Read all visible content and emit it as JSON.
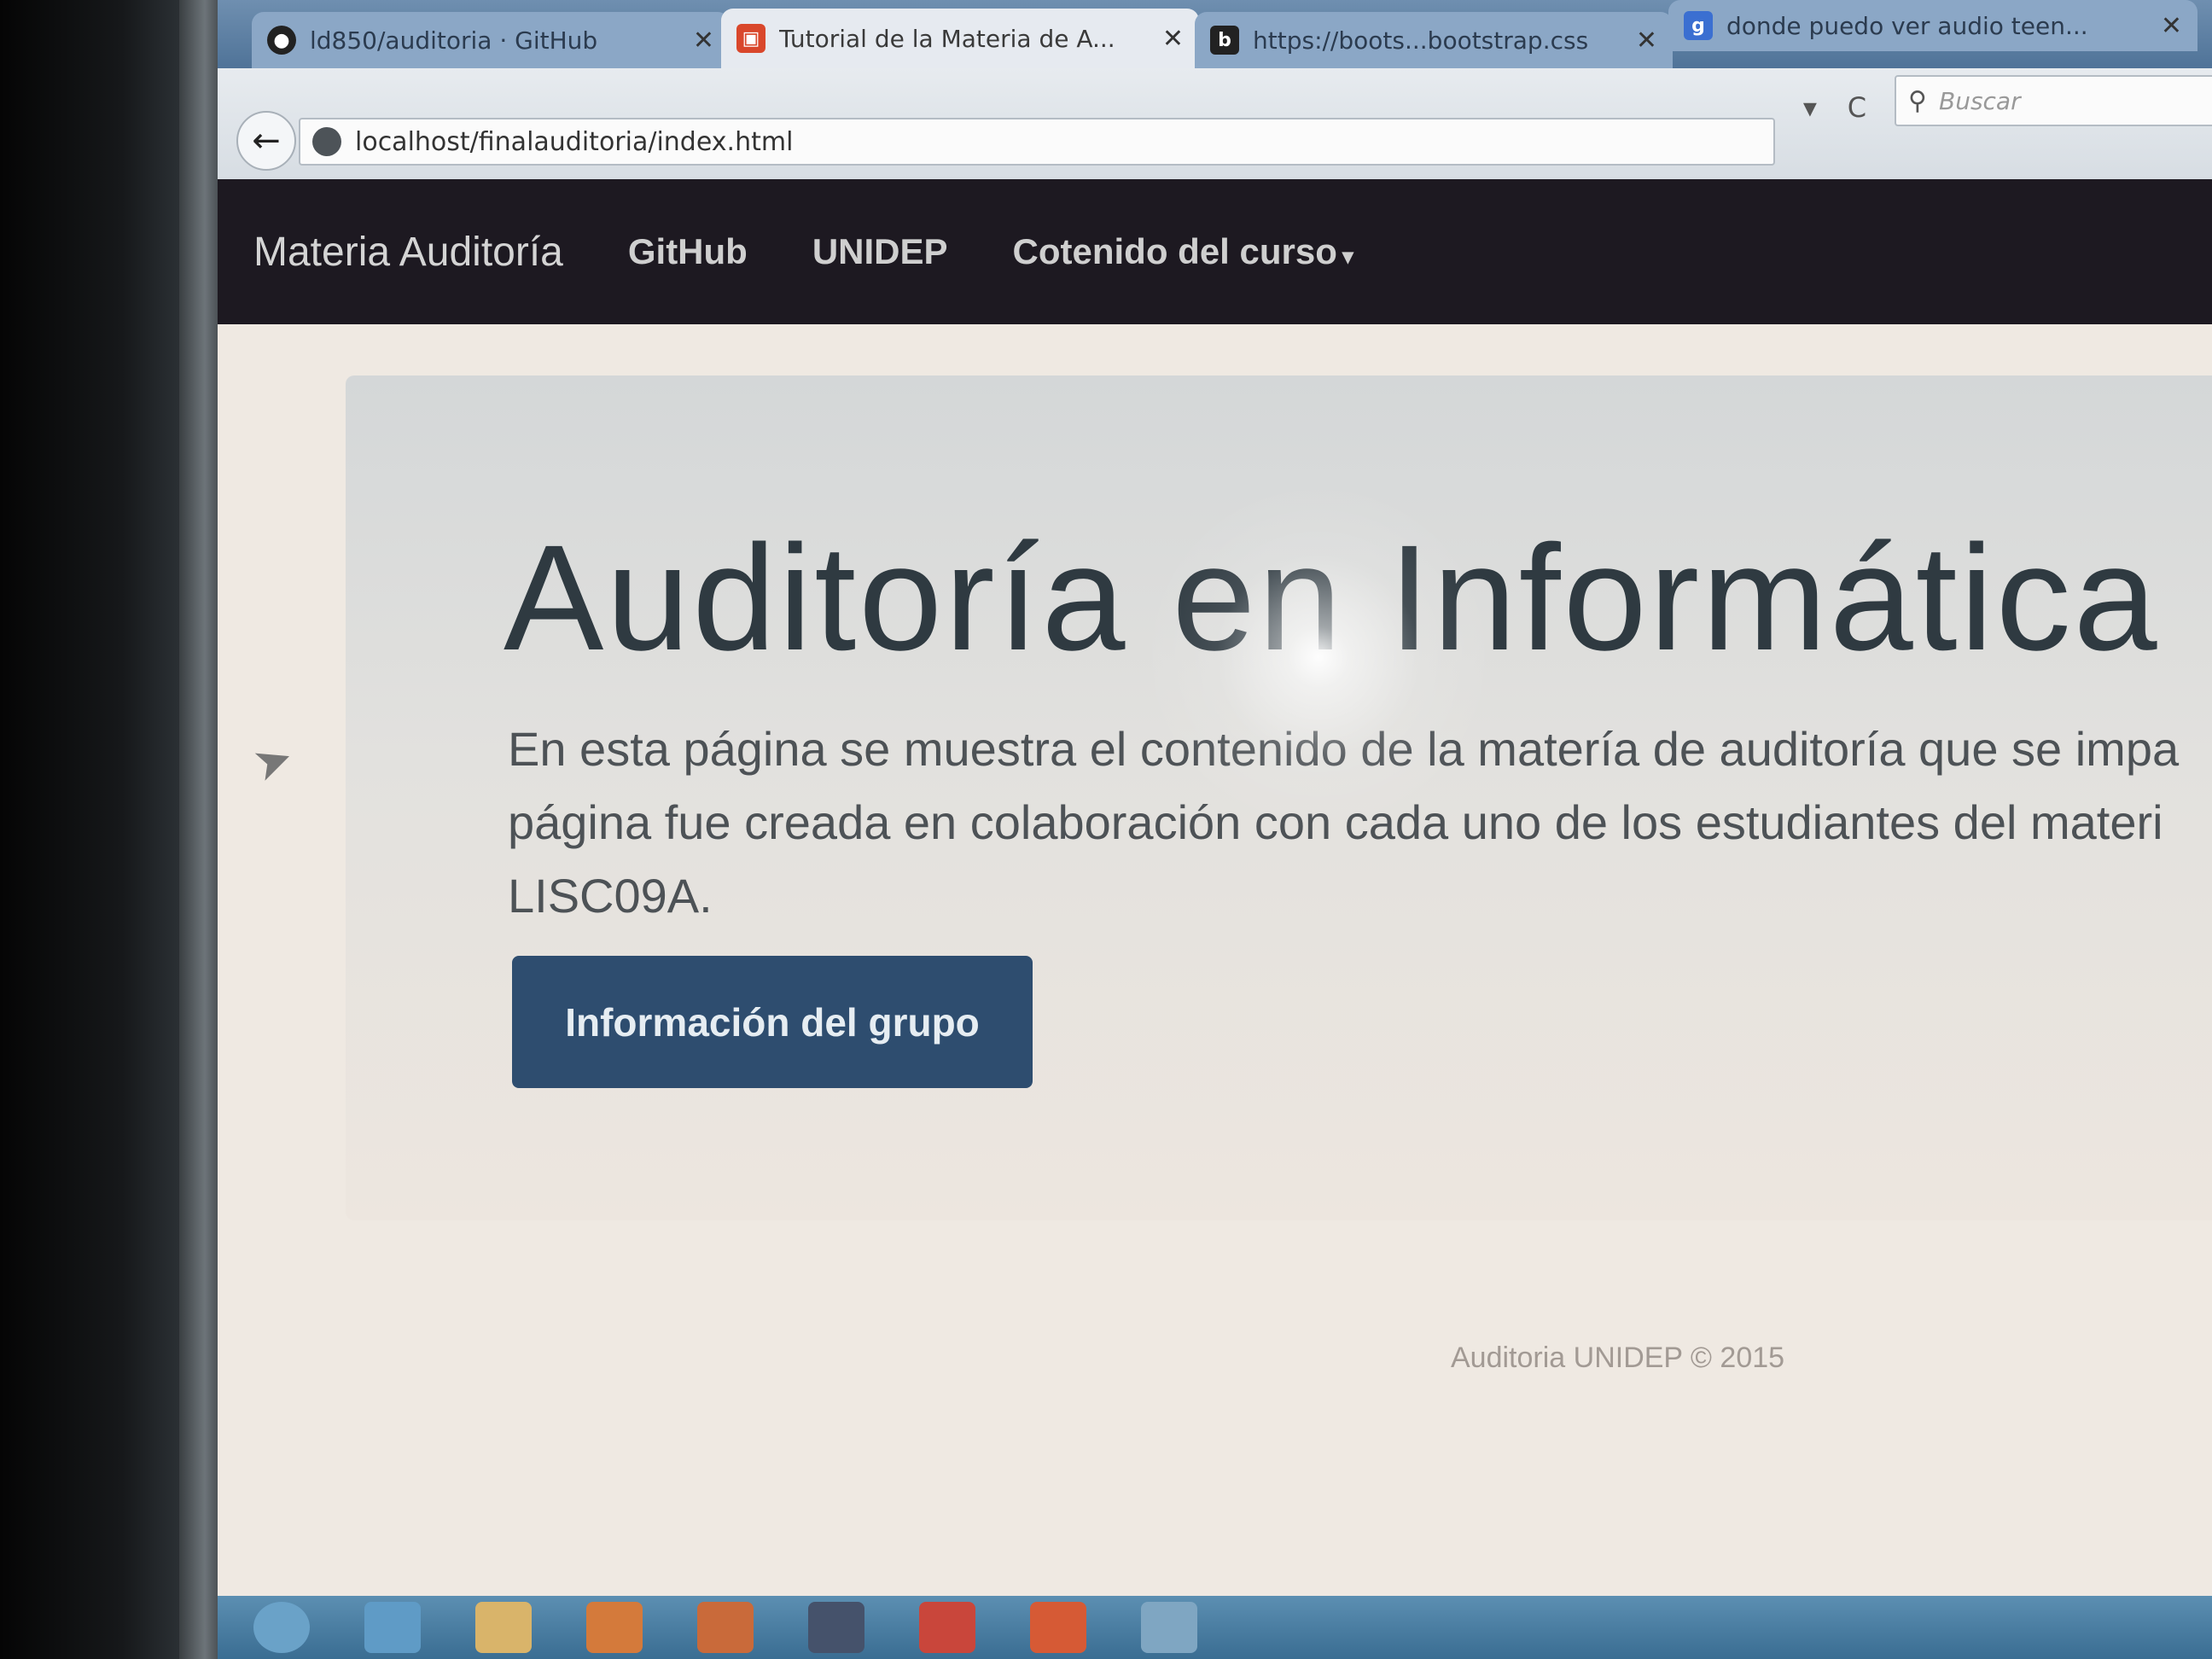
{
  "browser": {
    "tabs": [
      {
        "label": "ld850/auditoria · GitHub",
        "icon": "github-icon",
        "active": false
      },
      {
        "label": "Tutorial de la Materia de A...",
        "icon": "site-favicon-icon",
        "active": true
      },
      {
        "label": "https://boots...bootstrap.css",
        "icon": "bootstrap-icon",
        "active": false
      },
      {
        "label": "donde puedo ver audio teen...",
        "icon": "google-icon",
        "active": false
      }
    ],
    "close_glyph": "✕",
    "url": "localhost/finalauditoria/index.html",
    "search_placeholder": "Buscar",
    "back_glyph": "←",
    "dropdown_glyph": "▾",
    "reload_glyph": "C"
  },
  "navbar": {
    "brand": "Materia Auditoría",
    "links": [
      "GitHub",
      "UNIDEP",
      "Cotenido del curso"
    ],
    "caret": "▾"
  },
  "jumbotron": {
    "title": "Auditoría en Informática",
    "text_lines": [
      "En esta página se muestra el contenido de la matería de auditoría que se impa",
      "página fue creada en colaboración con cada uno de los estudiantes del materi",
      "LISC09A."
    ],
    "button_label": "Información del grupo"
  },
  "footer": {
    "text": "Auditoria UNIDEP © 2015"
  },
  "colors": {
    "navbar_bg": "#1d1921",
    "button_bg": "#2e4d6f",
    "taskbar_bg": "#4a7ea3"
  }
}
